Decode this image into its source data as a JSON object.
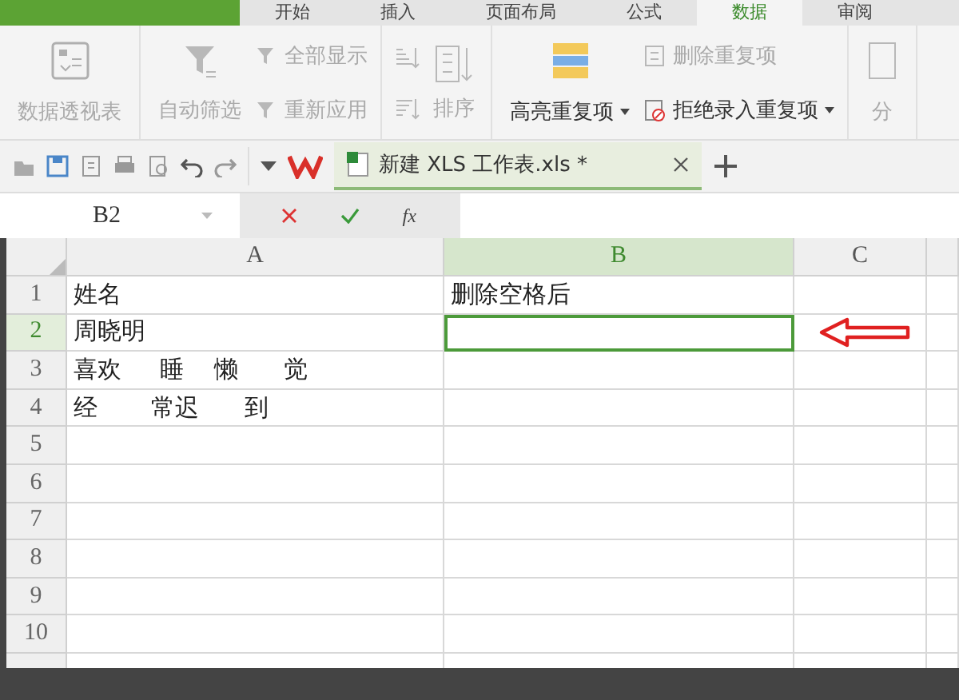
{
  "app_tabs": [
    {
      "label": "开始",
      "selected": false
    },
    {
      "label": "插入",
      "selected": false
    },
    {
      "label": "页面布局",
      "selected": false
    },
    {
      "label": "公式",
      "selected": false
    },
    {
      "label": "数据",
      "selected": true
    },
    {
      "label": "审阅",
      "selected": false
    }
  ],
  "ribbon": {
    "groups": [
      {
        "items": [
          {
            "kind": "large",
            "label": "数据透视表",
            "disabled": true
          }
        ]
      },
      {
        "items": [
          {
            "kind": "large",
            "label": "自动筛选",
            "disabled": true
          },
          {
            "kind": "stack",
            "items": [
              {
                "label": "全部显示",
                "disabled": true
              },
              {
                "label": "重新应用",
                "disabled": true
              }
            ]
          }
        ]
      },
      {
        "items": [
          {
            "kind": "stack",
            "items": [
              {
                "disabled": true
              },
              {
                "disabled": true
              }
            ]
          },
          {
            "kind": "large-side",
            "label": "排序",
            "disabled": true
          }
        ]
      },
      {
        "items": [
          {
            "kind": "large",
            "label": "高亮重复项",
            "dropdown": true,
            "disabled": false
          },
          {
            "kind": "stack",
            "items": [
              {
                "label": "删除重复项",
                "disabled": true
              },
              {
                "label": "拒绝录入重复项",
                "dropdown": true,
                "disabled": false
              }
            ]
          }
        ]
      },
      {
        "items": [
          {
            "kind": "large",
            "label": "分",
            "disabled": true
          }
        ]
      }
    ]
  },
  "doc_tab": {
    "title": "新建 XLS 工作表.xls *",
    "selected": true
  },
  "formula_bar": {
    "name_box": "B2",
    "fx": "fx"
  },
  "sheet": {
    "columns": [
      {
        "label": "A",
        "selected": false
      },
      {
        "label": "B",
        "selected": true
      },
      {
        "label": "C",
        "selected": false
      }
    ],
    "rows": [
      {
        "label": "1",
        "selected": false,
        "cells": [
          "姓名",
          "删除空格后"
        ]
      },
      {
        "label": "2",
        "selected": true,
        "cells": [
          "周晓明"
        ]
      },
      {
        "label": "3",
        "selected": false,
        "cells": [
          "喜欢     睡    懒      觉"
        ]
      },
      {
        "label": "4",
        "selected": false,
        "cells": [
          "经       常迟      到"
        ]
      },
      {
        "label": "5",
        "selected": false
      },
      {
        "label": "6",
        "selected": false
      },
      {
        "label": "7",
        "selected": false
      },
      {
        "label": "8",
        "selected": false
      },
      {
        "label": "9",
        "selected": false
      },
      {
        "label": "10",
        "selected": false
      }
    ]
  },
  "annotations": [
    {
      "kind": "arrow"
    }
  ]
}
